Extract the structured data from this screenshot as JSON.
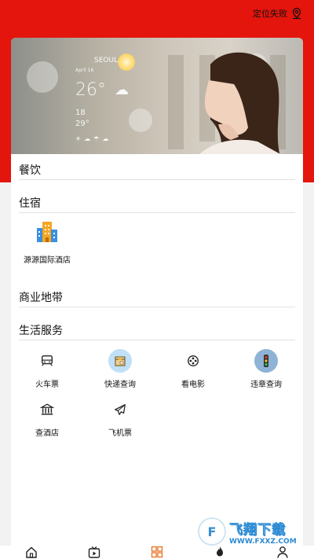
{
  "header": {
    "location_status": "定位失败"
  },
  "banner": {
    "weather_city": "SEOUL",
    "weather_date": "April 16",
    "weather_temp": "26°",
    "weather_low": "18",
    "weather_low2": "29°"
  },
  "sections": {
    "dining": "餐饮",
    "lodging": "住宿",
    "business": "商业地带",
    "life_services": "生活服务"
  },
  "lodging_items": [
    {
      "label": "源源国际酒店",
      "icon": "hotel-building-icon"
    }
  ],
  "services": [
    {
      "label": "火车票",
      "icon": "train-icon"
    },
    {
      "label": "快递查询",
      "icon": "package-icon"
    },
    {
      "label": "看电影",
      "icon": "film-reel-icon"
    },
    {
      "label": "违章查询",
      "icon": "traffic-light-icon"
    },
    {
      "label": "查酒店",
      "icon": "bank-building-icon"
    },
    {
      "label": "飞机票",
      "icon": "airplane-icon"
    }
  ],
  "watermark": {
    "title": "飞翔下载",
    "url": "WWW.FXXZ.COM"
  },
  "tabbar": {
    "items": [
      "home-icon",
      "video-icon",
      "grid-icon",
      "fire-icon",
      "user-icon"
    ],
    "active_index": 2
  },
  "colors": {
    "header_red": "#e3150d",
    "active_tab": "#e8772e"
  }
}
